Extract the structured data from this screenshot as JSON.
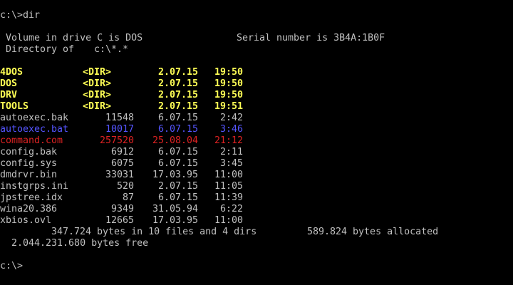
{
  "colors": {
    "background": "#000000",
    "default_text": "#c0c0c0",
    "directory": "#ffff55",
    "batch_file": "#5555ff",
    "command_file": "#dd2222"
  },
  "command": {
    "prompt": "c:\\>",
    "text": "dir"
  },
  "volume": {
    "label_line": "Volume in drive C is DOS",
    "serial_line": "Serial number is 3B4A:1B0F"
  },
  "directory_of": {
    "label": "Directory of",
    "path": "c:\\*.*"
  },
  "entries": [
    {
      "name": "4DOS",
      "size": "<DIR>",
      "date": "2.07.15",
      "time": "19:50",
      "kind": "dir"
    },
    {
      "name": "DOS",
      "size": "<DIR>",
      "date": "2.07.15",
      "time": "19:50",
      "kind": "dir"
    },
    {
      "name": "DRV",
      "size": "<DIR>",
      "date": "2.07.15",
      "time": "19:50",
      "kind": "dir"
    },
    {
      "name": "TOOLS",
      "size": "<DIR>",
      "date": "2.07.15",
      "time": "19:51",
      "kind": "dir"
    },
    {
      "name": "autoexec.bak",
      "size": "11548",
      "date": "6.07.15",
      "time": "2:42",
      "kind": "file"
    },
    {
      "name": "autoexec.bat",
      "size": "10017",
      "date": "6.07.15",
      "time": "3:46",
      "kind": "bat"
    },
    {
      "name": "command.com",
      "size": "257520",
      "date": "25.08.04",
      "time": "21:12",
      "kind": "com"
    },
    {
      "name": "config.bak",
      "size": "6912",
      "date": "6.07.15",
      "time": "2:11",
      "kind": "file"
    },
    {
      "name": "config.sys",
      "size": "6075",
      "date": "6.07.15",
      "time": "3:45",
      "kind": "file"
    },
    {
      "name": "dmdrvr.bin",
      "size": "33031",
      "date": "17.03.95",
      "time": "11:00",
      "kind": "file"
    },
    {
      "name": "instgrps.ini",
      "size": "520",
      "date": "2.07.15",
      "time": "11:05",
      "kind": "file"
    },
    {
      "name": "jpstree.idx",
      "size": "87",
      "date": "6.07.15",
      "time": "11:39",
      "kind": "file"
    },
    {
      "name": "wina20.386",
      "size": "9349",
      "date": "31.05.94",
      "time": "6:22",
      "kind": "file"
    },
    {
      "name": "xbios.ovl",
      "size": "12665",
      "date": "17.03.95",
      "time": "11:00",
      "kind": "file"
    }
  ],
  "summary": {
    "totals_line": "347.724 bytes in 10 files and 4 dirs",
    "allocated_line": "589.824 bytes allocated",
    "free_line": "2.044.231.680 bytes free"
  },
  "final_prompt": "c:\\>"
}
